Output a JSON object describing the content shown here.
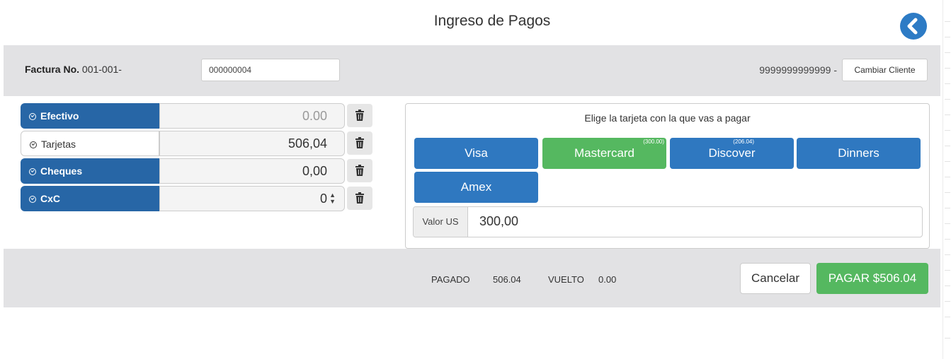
{
  "header": {
    "title": "Ingreso de Pagos",
    "back_icon": "chevron-left-circle-icon"
  },
  "invoice": {
    "label_bold": "Factura No.",
    "prefix": "001-001-",
    "number": "000000004",
    "client_id": "9999999999999 -",
    "change_client_label": "Cambiar Cliente"
  },
  "payments": [
    {
      "label": "Efectivo",
      "value": "0.00",
      "active": false
    },
    {
      "label": "Tarjetas",
      "value": "506,04",
      "active": true
    },
    {
      "label": "Cheques",
      "value": "0,00",
      "active": false
    },
    {
      "label": "CxC",
      "value": "0",
      "active": false
    }
  ],
  "cards": {
    "prompt": "Elige la tarjeta con la que vas a pagar",
    "items": [
      {
        "label": "Visa",
        "amount": "",
        "selected": false
      },
      {
        "label": "Mastercard",
        "amount": "(300.00)",
        "selected": true
      },
      {
        "label": "Discover",
        "amount": "(206.04)",
        "selected": false
      },
      {
        "label": "Dinners",
        "amount": "",
        "selected": false
      },
      {
        "label": "Amex",
        "amount": "",
        "selected": false
      }
    ],
    "value_label": "Valor US",
    "value": "300,00"
  },
  "footer": {
    "paid_label": "PAGADO",
    "paid_value": "506.04",
    "change_label": "VUELTO",
    "change_value": "0.00",
    "cancel_label": "Cancelar",
    "pay_label": "PAGAR $506.04"
  },
  "colors": {
    "primary": "#2766a6",
    "card_blue": "#2f78c0",
    "success": "#55b860",
    "bar": "#e2e2e4"
  }
}
